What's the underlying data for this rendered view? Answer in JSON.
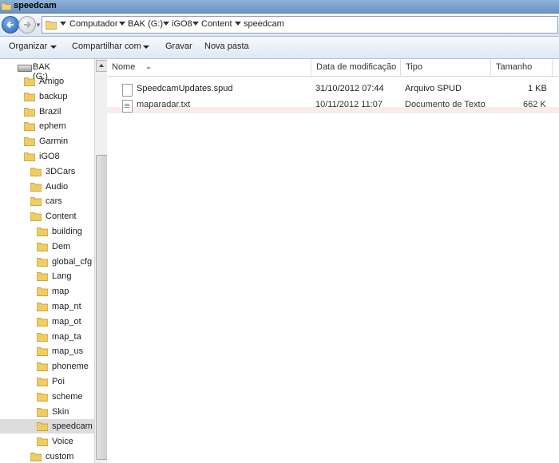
{
  "window": {
    "title": "speedcam"
  },
  "address": {
    "breadcrumbs": [
      "Computador",
      "BAK (G:)",
      "iGO8",
      "Content",
      "speedcam"
    ]
  },
  "toolbar": {
    "organize": "Organizar",
    "share": "Compartilhar com",
    "burn": "Gravar",
    "new_folder": "Nova pasta"
  },
  "nav": {
    "drive": "BAK (G:)",
    "items": [
      {
        "label": "Amigo",
        "level": 1
      },
      {
        "label": "backup",
        "level": 1
      },
      {
        "label": "Brazil",
        "level": 1
      },
      {
        "label": "ephem",
        "level": 1
      },
      {
        "label": "Garmin",
        "level": 1
      },
      {
        "label": "iGO8",
        "level": 1
      },
      {
        "label": "3DCars",
        "level": 2
      },
      {
        "label": "Audio",
        "level": 2
      },
      {
        "label": "cars",
        "level": 2
      },
      {
        "label": "Content",
        "level": 2
      },
      {
        "label": "building",
        "level": 3
      },
      {
        "label": "Dem",
        "level": 3
      },
      {
        "label": "global_cfg",
        "level": 3
      },
      {
        "label": "Lang",
        "level": 3
      },
      {
        "label": "map",
        "level": 3
      },
      {
        "label": "map_nt",
        "level": 3
      },
      {
        "label": "map_ot",
        "level": 3
      },
      {
        "label": "map_ta",
        "level": 3
      },
      {
        "label": "map_us",
        "level": 3
      },
      {
        "label": "phoneme",
        "level": 3
      },
      {
        "label": "Poi",
        "level": 3
      },
      {
        "label": "scheme",
        "level": 3
      },
      {
        "label": "Skin",
        "level": 3
      },
      {
        "label": "speedcam",
        "level": 3,
        "selected": true
      },
      {
        "label": "Voice",
        "level": 3
      },
      {
        "label": "custom",
        "level": 2
      }
    ]
  },
  "columns": {
    "name": "Nome",
    "modified": "Data de modificação",
    "type": "Tipo",
    "size": "Tamanho"
  },
  "files": [
    {
      "name": "SpeedcamUpdates.spud",
      "modified": "31/10/2012 07:44",
      "type": "Arquivo SPUD",
      "size": "1 KB",
      "icon": "file"
    },
    {
      "name": "maparadar.txt",
      "modified": "10/11/2012 11:07",
      "type": "Documento de Texto",
      "size": "662 K",
      "icon": "text"
    }
  ],
  "colors": {
    "folder": "#e8c25a",
    "selection": "#dcdcdc",
    "titlebar": "#6a93c4"
  }
}
